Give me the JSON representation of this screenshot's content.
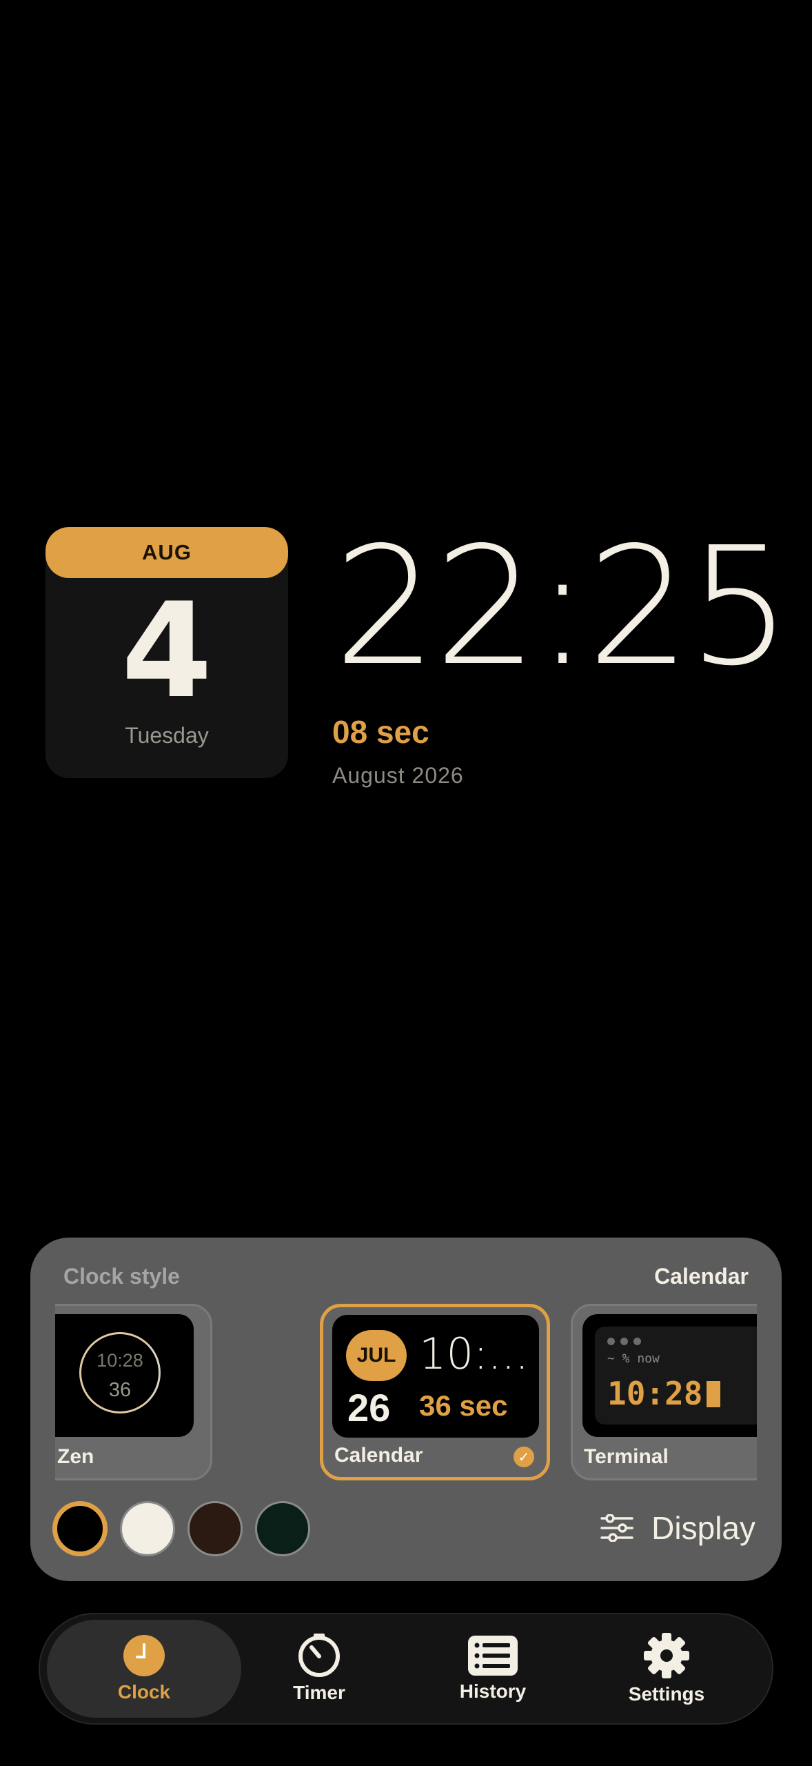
{
  "clock": {
    "month_badge": "AUG",
    "day": "4",
    "weekday": "Tuesday",
    "time": "22:25",
    "seconds": "08 sec",
    "month_year": "August 2026"
  },
  "style_panel": {
    "title": "Clock style",
    "current_style": "Calendar",
    "styles": [
      {
        "label": "Zen",
        "preview_time": "10:28",
        "preview_seconds": "36"
      },
      {
        "label": "Calendar",
        "preview_month": "JUL",
        "preview_day": "26",
        "preview_time": "10:...",
        "preview_seconds": "36 sec",
        "selected": true
      },
      {
        "label": "Terminal",
        "preview_prompt": "~ % now",
        "preview_time": "10:28"
      }
    ],
    "swatch_colors": [
      "#000000",
      "#f3efe4",
      "#2b1a12",
      "#0b1f19"
    ],
    "selected_swatch": 0,
    "display_label": "Display",
    "accent": "#dfa046"
  },
  "nav": {
    "items": [
      {
        "label": "Clock",
        "icon": "clock-icon",
        "active": true
      },
      {
        "label": "Timer",
        "icon": "timer-icon"
      },
      {
        "label": "History",
        "icon": "history-icon"
      },
      {
        "label": "Settings",
        "icon": "settings-icon"
      }
    ]
  }
}
